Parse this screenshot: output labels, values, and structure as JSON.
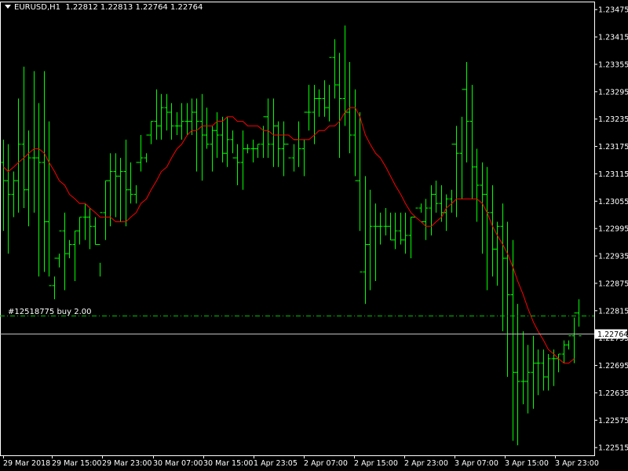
{
  "header": {
    "symbol_label": "EURUSD,H1",
    "ohlc_text": "1.22812 1.22813 1.22764 1.22764"
  },
  "order_line": {
    "label": "#12518775 buy 2.00",
    "price": 1.22805,
    "color": "#00c000"
  },
  "bid_line": {
    "price": 1.22764,
    "label": "1.22764",
    "color": "#c0c0c0"
  },
  "colors": {
    "background": "#000000",
    "bars": "#00ff00",
    "moving_average": "#ff0000",
    "axis": "#ffffff"
  },
  "chart_data": {
    "type": "line",
    "title": "",
    "xlabel": "",
    "ylabel": "",
    "ylim": [
      1.22505,
      1.23465
    ],
    "y_ticks": [
      "1.23475",
      "1.23415",
      "1.23355",
      "1.23295",
      "1.23235",
      "1.23175",
      "1.23115",
      "1.23055",
      "1.22995",
      "1.22935",
      "1.22875",
      "1.22815",
      "1.22755",
      "1.22695",
      "1.22635",
      "1.22575",
      "1.22515"
    ],
    "x_labels": [
      "29 Mar 2018",
      "29 Mar 15:00",
      "29 Mar 23:00",
      "30 Mar 07:00",
      "30 Mar 15:00",
      "1 Apr 23:05",
      "2 Apr 07:00",
      "2 Apr 15:00",
      "2 Apr 23:00",
      "3 Apr 07:00",
      "3 Apr 15:00",
      "3 Apr 23:00"
    ],
    "series": [
      {
        "kind": "ohlc_bars",
        "highs": [
          1.2319,
          1.2318,
          1.2312,
          1.2328,
          1.2335,
          1.2321,
          1.2334,
          1.2327,
          1.2334,
          1.2323,
          1.2289,
          1.2294,
          1.2303,
          1.2297,
          1.2299,
          1.2302,
          1.2305,
          1.2304,
          1.2302,
          1.2292,
          1.231,
          1.2316,
          1.2316,
          1.2315,
          1.2319,
          1.2314,
          1.2309,
          1.232,
          1.2316,
          1.2323,
          1.233,
          1.2329,
          1.2329,
          1.2327,
          1.2325,
          1.2327,
          1.2327,
          1.2328,
          1.2328,
          1.2329,
          1.2326,
          1.2322,
          1.2325,
          1.2324,
          1.2324,
          1.2321,
          1.2318,
          1.2321,
          1.2318,
          1.2319,
          1.2318,
          1.2322,
          1.2328,
          1.2328,
          1.2323,
          1.2323,
          1.2316,
          1.2318,
          1.2323,
          1.2319,
          1.2331,
          1.2331,
          1.233,
          1.2332,
          1.2331,
          1.2341,
          1.2338,
          1.2344,
          1.2336,
          1.233,
          1.2325,
          1.2311,
          1.2308,
          1.2305,
          1.2303,
          1.2304,
          1.2303,
          1.2303,
          1.2303,
          1.2303,
          1.2302,
          1.23,
          1.2305,
          1.2306,
          1.2309,
          1.231,
          1.2309,
          1.2307,
          1.2308,
          1.2322,
          1.2324,
          1.2336,
          1.2331,
          1.2317,
          1.2314,
          1.2313,
          1.2309,
          1.2301,
          1.2305,
          1.2301,
          1.2297,
          1.2283,
          1.2277,
          1.2274,
          1.2276,
          1.2273,
          1.2273,
          1.2272,
          1.2273,
          1.2272,
          1.2275,
          1.2275,
          1.228,
          1.2284
        ],
        "lows": [
          1.2299,
          1.2294,
          1.2302,
          1.2303,
          1.2304,
          1.23,
          1.2303,
          1.2289,
          1.229,
          1.2289,
          1.2284,
          1.2291,
          1.2286,
          1.2293,
          1.2288,
          1.2296,
          1.2297,
          1.2295,
          1.2296,
          1.2289,
          1.2297,
          1.23,
          1.2302,
          1.2301,
          1.23,
          1.2305,
          1.2305,
          1.2312,
          1.2314,
          1.2318,
          1.2319,
          1.2319,
          1.2321,
          1.2319,
          1.232,
          1.2319,
          1.232,
          1.232,
          1.2312,
          1.231,
          1.2317,
          1.2312,
          1.2315,
          1.2314,
          1.2313,
          1.2316,
          1.2309,
          1.2308,
          1.2316,
          1.2314,
          1.2315,
          1.2315,
          1.2315,
          1.2313,
          1.2313,
          1.2311,
          1.2316,
          1.2312,
          1.2313,
          1.2311,
          1.2321,
          1.2318,
          1.2324,
          1.2324,
          1.2323,
          1.2328,
          1.2315,
          1.2322,
          1.2316,
          1.2311,
          1.2299,
          1.2283,
          1.2286,
          1.2288,
          1.2296,
          1.2298,
          1.2297,
          1.2295,
          1.2296,
          1.2294,
          1.2293,
          1.23,
          1.2303,
          1.2297,
          1.2298,
          1.2303,
          1.2301,
          1.2299,
          1.2303,
          1.2302,
          1.2306,
          1.2314,
          1.2306,
          1.2301,
          1.2294,
          1.2286,
          1.2289,
          1.2287,
          1.2277,
          1.2267,
          1.2253,
          1.2252,
          1.2261,
          1.2259,
          1.226,
          1.2263,
          1.2264,
          1.2264,
          1.2265,
          1.2268,
          1.227,
          1.2273,
          1.227,
          1.2278
        ],
        "opens": [
          1.2314,
          1.231,
          1.2307,
          1.231,
          1.2318,
          1.2308,
          1.2315,
          1.2315,
          1.2314,
          1.2301,
          1.2287,
          1.2293,
          1.2299,
          1.2294,
          1.2296,
          1.2299,
          1.2302,
          1.2302,
          1.23,
          1.2296,
          1.2303,
          1.231,
          1.2312,
          1.2311,
          1.2312,
          1.2308,
          1.2307,
          1.2314,
          1.2315,
          1.232,
          1.2323,
          1.2322,
          1.2326,
          1.2325,
          1.2322,
          1.2322,
          1.2323,
          1.2323,
          1.2325,
          1.2323,
          1.232,
          1.2318,
          1.2321,
          1.232,
          1.2316,
          1.2319,
          1.2315,
          1.2314,
          1.2317,
          1.2317,
          1.2317,
          1.2318,
          1.2324,
          1.2318,
          1.2322,
          1.2317,
          1.2318,
          1.2315,
          1.2319,
          1.2317,
          1.2325,
          1.2325,
          1.2328,
          1.2328,
          1.2326,
          1.2337,
          1.2331,
          1.2328,
          1.2325,
          1.232,
          1.231,
          1.229,
          1.2296,
          1.23,
          1.23,
          1.23,
          1.23,
          1.2297,
          1.2299,
          1.2297,
          1.2298,
          1.2302,
          1.2304,
          1.2301,
          1.2304,
          1.2307,
          1.2305,
          1.2303,
          1.2306,
          1.2318,
          1.2316,
          1.233,
          1.2323,
          1.2313,
          1.2309,
          1.2307,
          1.2303,
          1.2295,
          1.23,
          1.2293,
          1.2285,
          1.2268,
          1.2266,
          1.2266,
          1.2268,
          1.227,
          1.227,
          1.2267,
          1.2271,
          1.2271,
          1.2272,
          1.2274,
          1.2276,
          1.2281
        ],
        "closes": [
          1.231,
          1.2307,
          1.231,
          1.2318,
          1.2308,
          1.2315,
          1.2315,
          1.2314,
          1.2301,
          1.2287,
          1.2293,
          1.2299,
          1.2294,
          1.2296,
          1.2299,
          1.2302,
          1.2302,
          1.23,
          1.2296,
          1.2303,
          1.231,
          1.2312,
          1.2311,
          1.2312,
          1.2308,
          1.2307,
          1.2314,
          1.2315,
          1.232,
          1.2323,
          1.2322,
          1.2326,
          1.2325,
          1.2322,
          1.2322,
          1.2323,
          1.2323,
          1.2325,
          1.2323,
          1.232,
          1.2318,
          1.2321,
          1.232,
          1.2316,
          1.2319,
          1.2315,
          1.2314,
          1.2317,
          1.2317,
          1.2317,
          1.2318,
          1.2324,
          1.2318,
          1.2322,
          1.2317,
          1.2318,
          1.2315,
          1.2319,
          1.2317,
          1.2325,
          1.2325,
          1.2328,
          1.2328,
          1.2326,
          1.2337,
          1.2331,
          1.2328,
          1.2325,
          1.232,
          1.231,
          1.229,
          1.2296,
          1.23,
          1.23,
          1.23,
          1.23,
          1.2297,
          1.2299,
          1.2297,
          1.2298,
          1.2302,
          1.2304,
          1.2301,
          1.2304,
          1.2307,
          1.2305,
          1.2303,
          1.2306,
          1.2318,
          1.2316,
          1.233,
          1.2323,
          1.2313,
          1.2309,
          1.2307,
          1.2303,
          1.2295,
          1.23,
          1.2293,
          1.2285,
          1.2268,
          1.2266,
          1.2266,
          1.2268,
          1.227,
          1.227,
          1.2267,
          1.2271,
          1.2271,
          1.2272,
          1.2274,
          1.2276,
          1.2281,
          1.2276
        ]
      },
      {
        "kind": "moving_average",
        "values": [
          1.2313,
          1.2312,
          1.2313,
          1.2314,
          1.2315,
          1.2316,
          1.2317,
          1.2317,
          1.2316,
          1.2314,
          1.2312,
          1.231,
          1.2309,
          1.2307,
          1.2306,
          1.2305,
          1.2305,
          1.2304,
          1.2303,
          1.2302,
          1.2302,
          1.2302,
          1.2301,
          1.2301,
          1.2301,
          1.2302,
          1.2303,
          1.2305,
          1.2306,
          1.2308,
          1.231,
          1.2312,
          1.2313,
          1.2315,
          1.2317,
          1.2318,
          1.232,
          1.2321,
          1.2321,
          1.2322,
          1.2322,
          1.2322,
          1.2323,
          1.2323,
          1.2324,
          1.2324,
          1.2323,
          1.2323,
          1.2322,
          1.2322,
          1.2322,
          1.2321,
          1.2321,
          1.232,
          1.232,
          1.232,
          1.232,
          1.2319,
          1.2319,
          1.2319,
          1.2319,
          1.232,
          1.2321,
          1.2321,
          1.2322,
          1.2322,
          1.2323,
          1.2325,
          1.2326,
          1.2326,
          1.2324,
          1.232,
          1.2318,
          1.2316,
          1.2315,
          1.2313,
          1.2311,
          1.2309,
          1.2307,
          1.2305,
          1.2303,
          1.2302,
          1.2301,
          1.23,
          1.23,
          1.2301,
          1.2302,
          1.2304,
          1.2305,
          1.2306,
          1.2306,
          1.2306,
          1.2306,
          1.2306,
          1.2305,
          1.2303,
          1.23,
          1.2298,
          1.2296,
          1.2294,
          1.2291,
          1.2288,
          1.2285,
          1.2282,
          1.2279,
          1.2277,
          1.2275,
          1.2273,
          1.2272,
          1.2271,
          1.227,
          1.227,
          1.2271
        ]
      }
    ],
    "grid": false,
    "legend": "none"
  }
}
